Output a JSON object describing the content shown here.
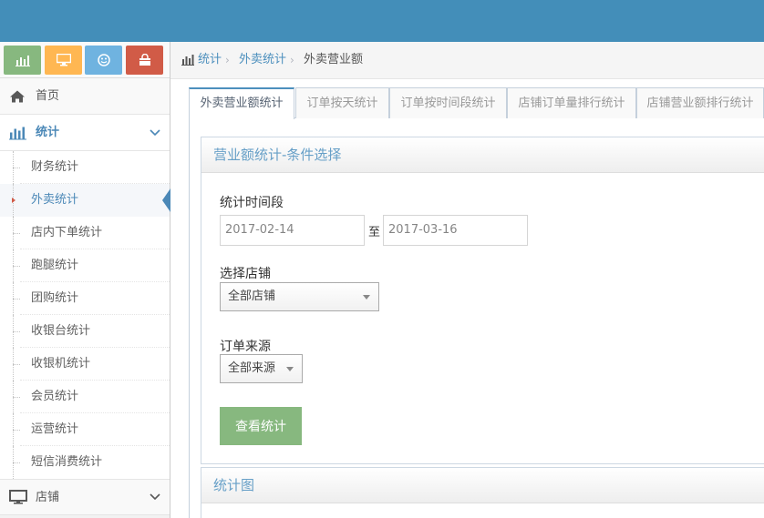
{
  "colors": {
    "topbar": "#438eb9",
    "accent": "#4b88b7",
    "shortcut_green": "#87b87f",
    "shortcut_orange": "#ffb752",
    "shortcut_blue": "#6fb3e0",
    "shortcut_red": "#d15b47",
    "button_green": "#87b87f"
  },
  "shortcuts": [
    {
      "icon": "bar-chart-icon"
    },
    {
      "icon": "desktop-icon"
    },
    {
      "icon": "smile-icon"
    },
    {
      "icon": "shopping-bag-icon"
    }
  ],
  "sidebar": {
    "home": {
      "label": "首页",
      "icon": "home-icon"
    },
    "stats": {
      "label": "统计",
      "icon": "bar-chart-icon",
      "expanded": true
    },
    "sub_items": [
      {
        "label": "财务统计"
      },
      {
        "label": "外卖统计"
      },
      {
        "label": "店内下单统计"
      },
      {
        "label": "跑腿统计"
      },
      {
        "label": "团购统计"
      },
      {
        "label": "收银台统计"
      },
      {
        "label": "收银机统计"
      },
      {
        "label": "会员统计"
      },
      {
        "label": "运营统计"
      },
      {
        "label": "短信消费统计"
      }
    ],
    "active_sub": "外卖统计",
    "store": {
      "label": "店铺",
      "icon": "desktop-icon"
    }
  },
  "breadcrumb": {
    "items": [
      "统计",
      "外卖统计",
      "外卖营业额"
    ]
  },
  "tabs": [
    {
      "label": "外卖营业额统计"
    },
    {
      "label": "订单按天统计"
    },
    {
      "label": "订单按时间段统计"
    },
    {
      "label": "店铺订单量排行统计"
    },
    {
      "label": "店铺营业额排行统计"
    }
  ],
  "filter_panel": {
    "title": "营业额统计-条件选择",
    "period_label": "统计时间段",
    "start_date": "2017-02-14",
    "to_label": "至",
    "end_date": "2017-03-16",
    "store_label": "选择店铺",
    "store_value": "全部店铺",
    "source_label": "订单来源",
    "source_value": "全部来源",
    "submit_label": "查看统计"
  },
  "chart_panel": {
    "title": "统计图"
  }
}
